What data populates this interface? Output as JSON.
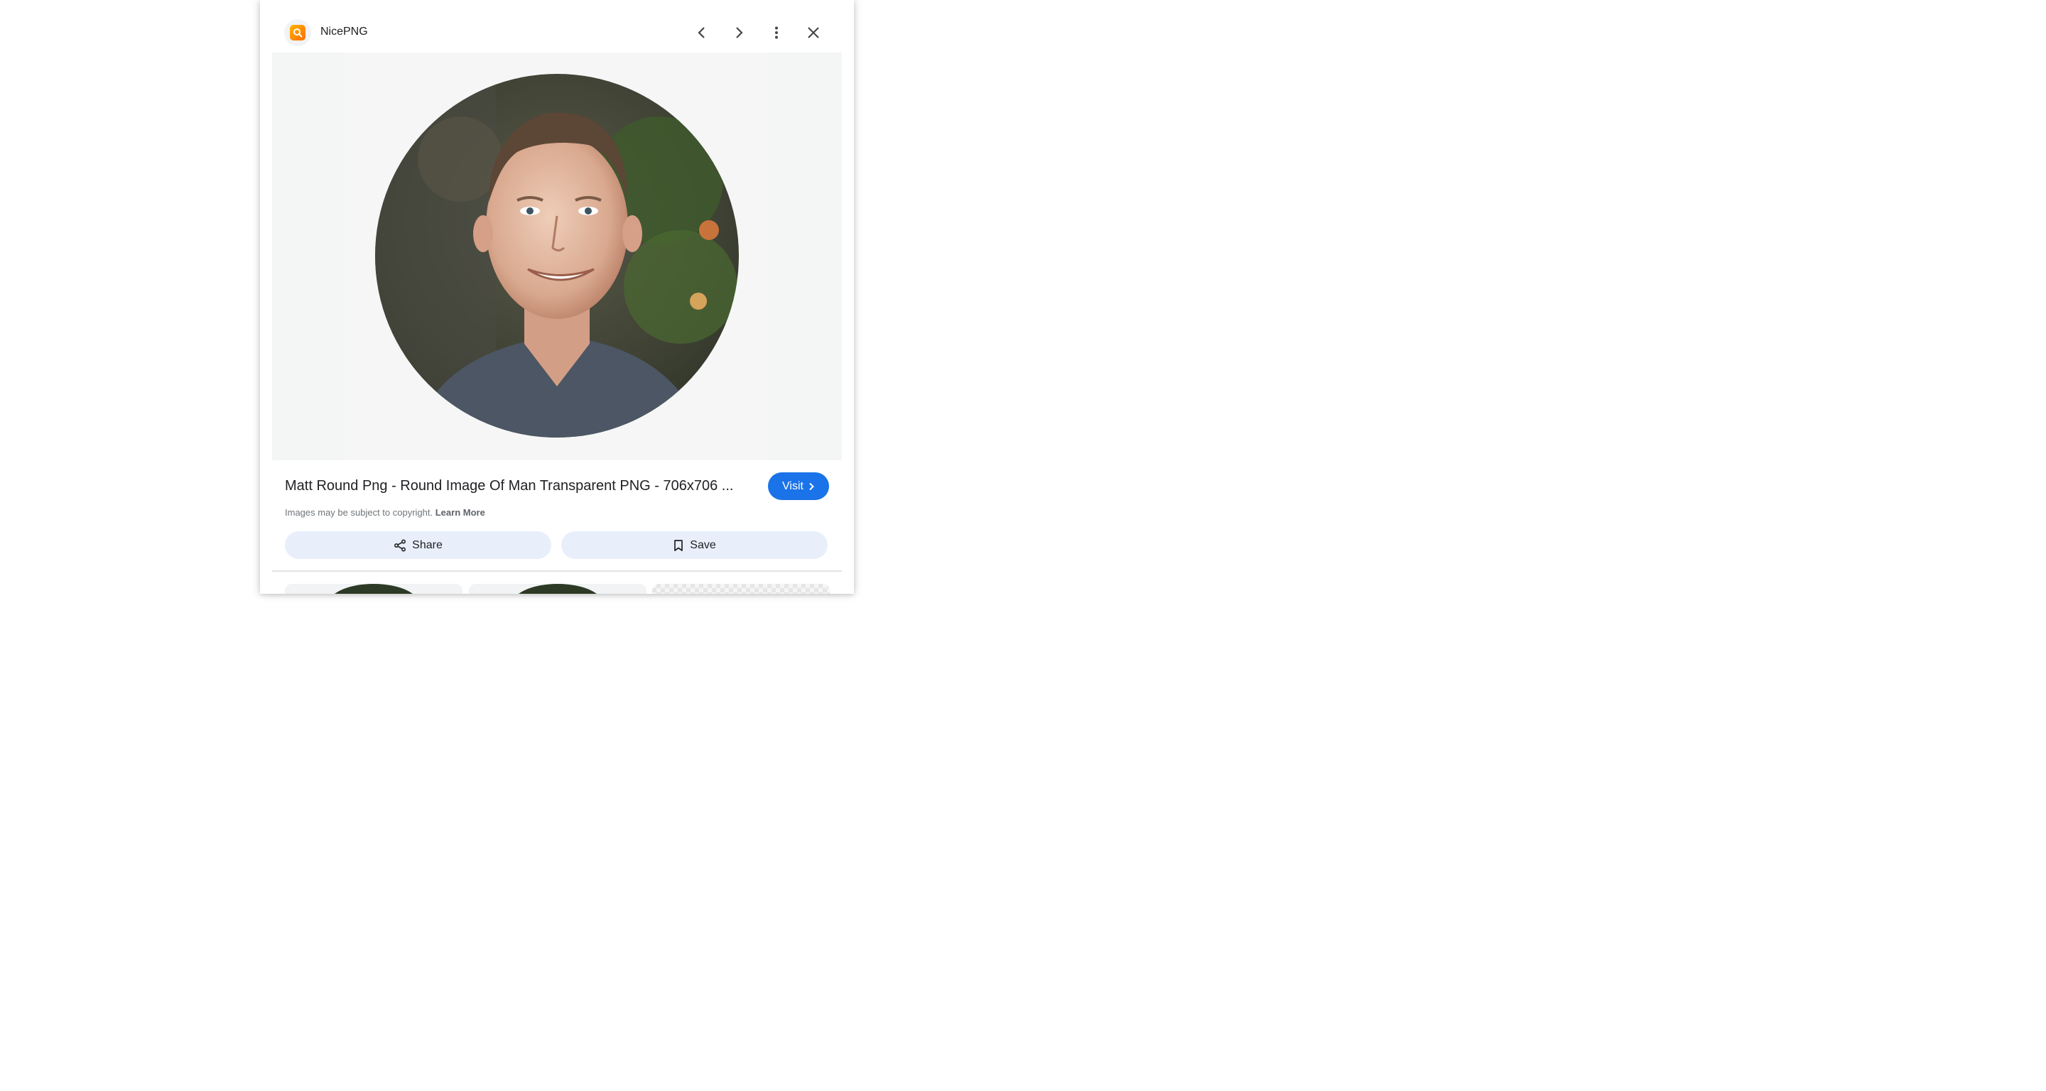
{
  "header": {
    "site_name": "NicePNG",
    "logo_icon": "magnifier-logo-icon",
    "brand_color": "#ff8f00"
  },
  "nav": {
    "prev_icon": "chevron-left-icon",
    "next_icon": "chevron-right-icon",
    "more_icon": "more-vert-icon",
    "close_icon": "close-icon"
  },
  "image": {
    "subject": "round portrait photo"
  },
  "result": {
    "title": "Matt Round Png - Round Image Of Man Transparent PNG - 706x706 ...",
    "visit_label": "Visit",
    "copyright_text": "Images may be subject to copyright.",
    "learn_more_label": "Learn More"
  },
  "actions": {
    "share_label": "Share",
    "save_label": "Save"
  },
  "colors": {
    "accent": "#1a73e8",
    "pill_bg": "#e8effb"
  }
}
